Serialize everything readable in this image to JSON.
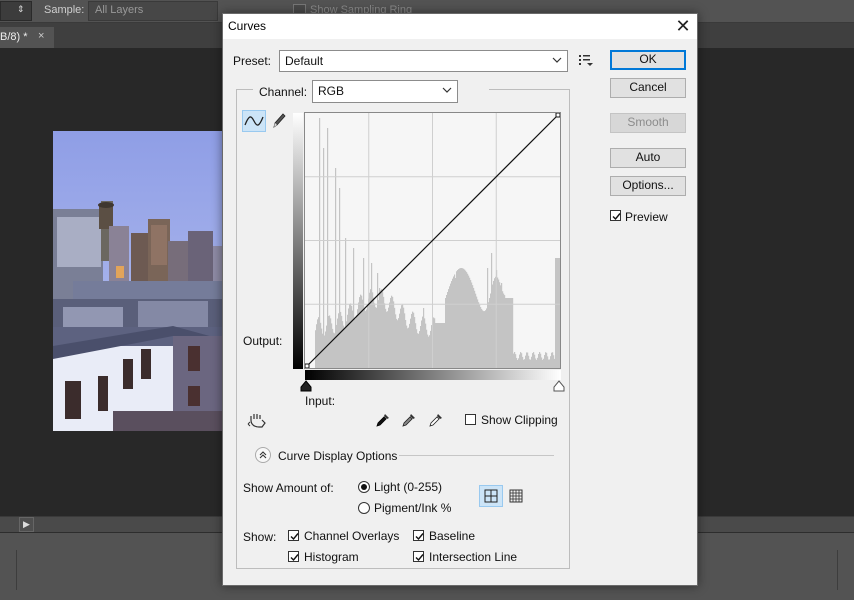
{
  "ps_toolbar": {
    "sample_label": "Sample:",
    "sample_value": "All Layers",
    "ring_label": "Show Sampling Ring"
  },
  "document_tab": {
    "title": "B/8) *",
    "close": "×"
  },
  "dialog": {
    "title": "Curves",
    "close": "✕",
    "preset_label": "Preset:",
    "preset_value": "Default",
    "channel_label": "Channel:",
    "channel_value": "RGB",
    "output_label": "Output:",
    "input_label": "Input:",
    "show_clipping_label": "Show Clipping",
    "show_clipping_checked": false,
    "curve_display_options_label": "Curve Display Options",
    "show_amount_label": "Show Amount of:",
    "light_label": "Light  (0-255)",
    "pigment_label": "Pigment/Ink %",
    "light_selected": true,
    "show_label": "Show:",
    "channel_overlays_label": "Channel Overlays",
    "baseline_label": "Baseline",
    "histogram_label": "Histogram",
    "intersection_line_label": "Intersection Line",
    "channel_overlays_checked": true,
    "baseline_checked": true,
    "histogram_checked": true,
    "intersection_line_checked": true,
    "buttons": {
      "ok": "OK",
      "cancel": "Cancel",
      "smooth": "Smooth",
      "auto": "Auto",
      "options": "Options..."
    },
    "preview_label": "Preview",
    "preview_checked": true
  },
  "colors": {
    "accent": "#0078d7",
    "histogram": "#c4c4c4",
    "grid_bg": "#f6f6f6"
  },
  "icons": [
    "curve-tool-icon",
    "pencil-icon",
    "preset-options-icon",
    "targeted-adjustment-icon",
    "black-point-eyedropper-icon",
    "gray-point-eyedropper-icon",
    "white-point-eyedropper-icon",
    "expand-icon",
    "grid-4x4-icon",
    "grid-10x10-icon",
    "play-icon"
  ]
}
